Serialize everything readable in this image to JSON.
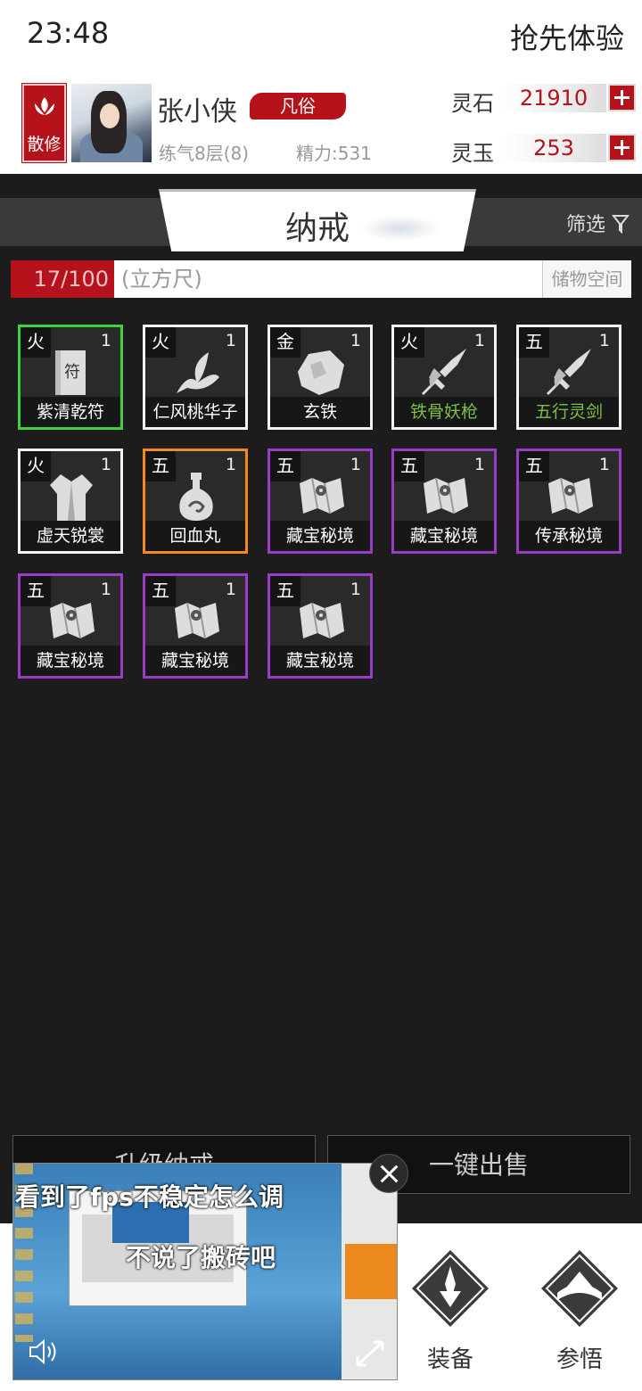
{
  "status": {
    "time": "23:48",
    "early_access": "抢先体验"
  },
  "player": {
    "sect": "散修",
    "name": "张小侠",
    "rank": "凡俗",
    "level": "练气8层(8)",
    "energy": "精力:531"
  },
  "currency": [
    {
      "label": "灵石",
      "value": "21910"
    },
    {
      "label": "灵玉",
      "value": "253"
    }
  ],
  "tabs": {
    "title": "纳戒",
    "filter": "筛选"
  },
  "capacity": {
    "used": "17/100",
    "unit": "(立方尺)",
    "storage": "储物空间"
  },
  "items": [
    {
      "element": "火",
      "qty": "1",
      "name": "紫清乾符",
      "rarity": "green",
      "icon": "talisman-icon"
    },
    {
      "element": "火",
      "qty": "1",
      "name": "仁风桃华子",
      "rarity": "white",
      "icon": "leaf-icon"
    },
    {
      "element": "金",
      "qty": "1",
      "name": "玄铁",
      "rarity": "white",
      "icon": "ore-icon"
    },
    {
      "element": "火",
      "qty": "1",
      "name": "铁骨妖枪",
      "rarity": "white",
      "icon": "weapon-icon",
      "name_color": "green"
    },
    {
      "element": "五",
      "qty": "1",
      "name": "五行灵剑",
      "rarity": "white",
      "icon": "weapon-icon",
      "name_color": "green"
    },
    {
      "element": "火",
      "qty": "1",
      "name": "虚天锐裳",
      "rarity": "white",
      "icon": "robe-icon"
    },
    {
      "element": "五",
      "qty": "1",
      "name": "回血丸",
      "rarity": "orange",
      "icon": "potion-icon"
    },
    {
      "element": "五",
      "qty": "1",
      "name": "藏宝秘境",
      "rarity": "purple",
      "icon": "map-scroll-icon"
    },
    {
      "element": "五",
      "qty": "1",
      "name": "藏宝秘境",
      "rarity": "purple",
      "icon": "map-scroll-icon"
    },
    {
      "element": "五",
      "qty": "1",
      "name": "传承秘境",
      "rarity": "purple",
      "icon": "map-scroll-icon"
    },
    {
      "element": "五",
      "qty": "1",
      "name": "藏宝秘境",
      "rarity": "purple",
      "icon": "map-scroll-icon"
    },
    {
      "element": "五",
      "qty": "1",
      "name": "藏宝秘境",
      "rarity": "purple",
      "icon": "map-scroll-icon"
    },
    {
      "element": "五",
      "qty": "1",
      "name": "藏宝秘境",
      "rarity": "purple",
      "icon": "map-scroll-icon"
    }
  ],
  "buttons": {
    "upgrade": "升级纳戒",
    "sell_all": "一键出售"
  },
  "nav": [
    {
      "label": "装备",
      "icon": "equipment-icon"
    },
    {
      "label": "参悟",
      "icon": "comprehend-icon"
    }
  ],
  "video_overlay": {
    "caption_top": "看到了fps不稳定怎么调",
    "caption_mid": "不说了搬砖吧"
  },
  "colors": {
    "accent_red": "#b5121b",
    "green": "#3fd13f",
    "orange": "#f28a1b",
    "purple": "#9b3cc7"
  }
}
